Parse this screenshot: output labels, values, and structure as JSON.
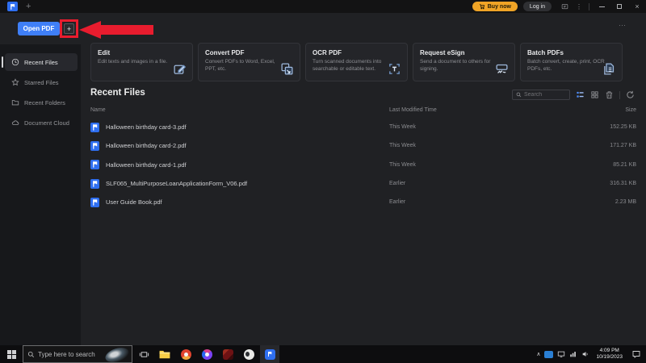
{
  "titlebar": {
    "new_tab_glyph": "+",
    "buy_now": "Buy now",
    "log_in": "Log in",
    "kebab_glyph": "⋮"
  },
  "toolbar": {
    "open_pdf": "Open PDF",
    "plus_glyph": "+",
    "overflow_glyph": "⋯"
  },
  "sidebar": {
    "items": [
      {
        "label": "Recent Files",
        "active": true
      },
      {
        "label": "Starred Files",
        "active": false
      },
      {
        "label": "Recent Folders",
        "active": false
      },
      {
        "label": "Document Cloud",
        "active": false
      }
    ]
  },
  "cards": [
    {
      "title": "Edit",
      "desc": "Edit texts and images in a file.",
      "icon": "edit-icon"
    },
    {
      "title": "Convert PDF",
      "desc": "Convert PDFs to Word, Excel, PPT, etc.",
      "icon": "convert-icon"
    },
    {
      "title": "OCR PDF",
      "desc": "Turn scanned documents into searchable or editable text.",
      "icon": "ocr-icon"
    },
    {
      "title": "Request eSign",
      "desc": "Send a document to others for signing.",
      "icon": "esign-icon"
    },
    {
      "title": "Batch PDFs",
      "desc": "Batch convert, create, print, OCR PDFs, etc.",
      "icon": "batch-icon"
    }
  ],
  "recent": {
    "heading": "Recent Files",
    "search_placeholder": "Search",
    "columns": {
      "name": "Name",
      "modified": "Last Modified Time",
      "size": "Size"
    },
    "files": [
      {
        "name": "Halloween birthday card-3.pdf",
        "modified": "This Week",
        "size": "152.25 KB"
      },
      {
        "name": "Halloween birthday card-2.pdf",
        "modified": "This Week",
        "size": "171.27 KB"
      },
      {
        "name": "Halloween birthday card-1.pdf",
        "modified": "This Week",
        "size": "85.21 KB"
      },
      {
        "name": "SLF065_MultiPurposeLoanApplicationForm_V06.pdf",
        "modified": "Earlier",
        "size": "316.31 KB"
      },
      {
        "name": "User Guide Book.pdf",
        "modified": "Earlier",
        "size": "2.23 MB"
      }
    ]
  },
  "taskbar": {
    "search_placeholder": "Type here to search",
    "tray": {
      "chevron_glyph": "∧",
      "time": "4:09 PM",
      "date": "10/19/2023"
    }
  },
  "colors": {
    "accent_blue": "#3f7ff7",
    "pdf_icon_blue": "#2f6ff0",
    "buy_now_yellow": "#f0a426",
    "annotation_red": "#e81c2e",
    "background_dark": "#202124",
    "sidebar_dark": "#17181b",
    "card_bg": "#242529",
    "taskbar_black": "#0d0d0f"
  }
}
